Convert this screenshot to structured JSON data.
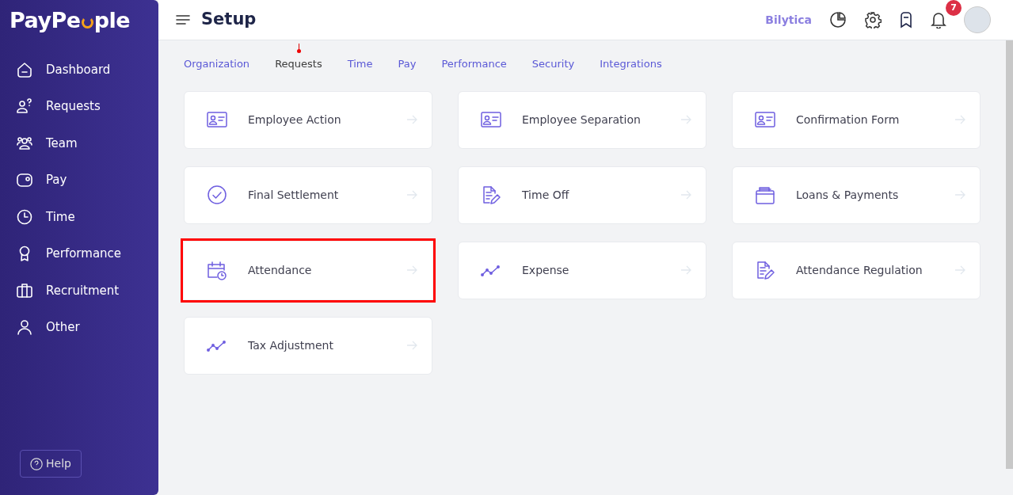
{
  "logo": {
    "text_start": "PayPe",
    "text_end": "ple"
  },
  "sidebar": {
    "items": [
      {
        "label": "Dashboard",
        "kind": "home"
      },
      {
        "label": "Requests",
        "kind": "requests"
      },
      {
        "label": "Team",
        "kind": "team"
      },
      {
        "label": "Pay",
        "kind": "wallet"
      },
      {
        "label": "Time",
        "kind": "clock"
      },
      {
        "label": "Performance",
        "kind": "award"
      },
      {
        "label": "Recruitment",
        "kind": "briefcase"
      },
      {
        "label": "Other",
        "kind": "person"
      }
    ],
    "help": "Help"
  },
  "header": {
    "title": "Setup",
    "company": "Bilytica",
    "notification_count": "7"
  },
  "tabs": [
    {
      "label": "Organization",
      "selected": false
    },
    {
      "label": "Requests",
      "selected": true
    },
    {
      "label": "Time",
      "selected": false
    },
    {
      "label": "Pay",
      "selected": false
    },
    {
      "label": "Performance",
      "selected": false
    },
    {
      "label": "Security",
      "selected": false
    },
    {
      "label": "Integrations",
      "selected": false
    }
  ],
  "cards": [
    {
      "label": "Employee Action",
      "kind": "idcard",
      "highlighted": false
    },
    {
      "label": "Employee Separation",
      "kind": "idcard",
      "highlighted": false
    },
    {
      "label": "Confirmation Form",
      "kind": "idcard",
      "highlighted": false
    },
    {
      "label": "Final Settlement",
      "kind": "check",
      "highlighted": false
    },
    {
      "label": "Time Off",
      "kind": "docpen",
      "highlighted": false
    },
    {
      "label": "Loans & Payments",
      "kind": "folder",
      "highlighted": false
    },
    {
      "label": "Attendance",
      "kind": "calclock",
      "highlighted": true
    },
    {
      "label": "Expense",
      "kind": "trend",
      "highlighted": false
    },
    {
      "label": "Attendance Regulation",
      "kind": "docpen",
      "highlighted": false
    },
    {
      "label": "Tax Adjustment",
      "kind": "trend",
      "highlighted": false
    }
  ]
}
